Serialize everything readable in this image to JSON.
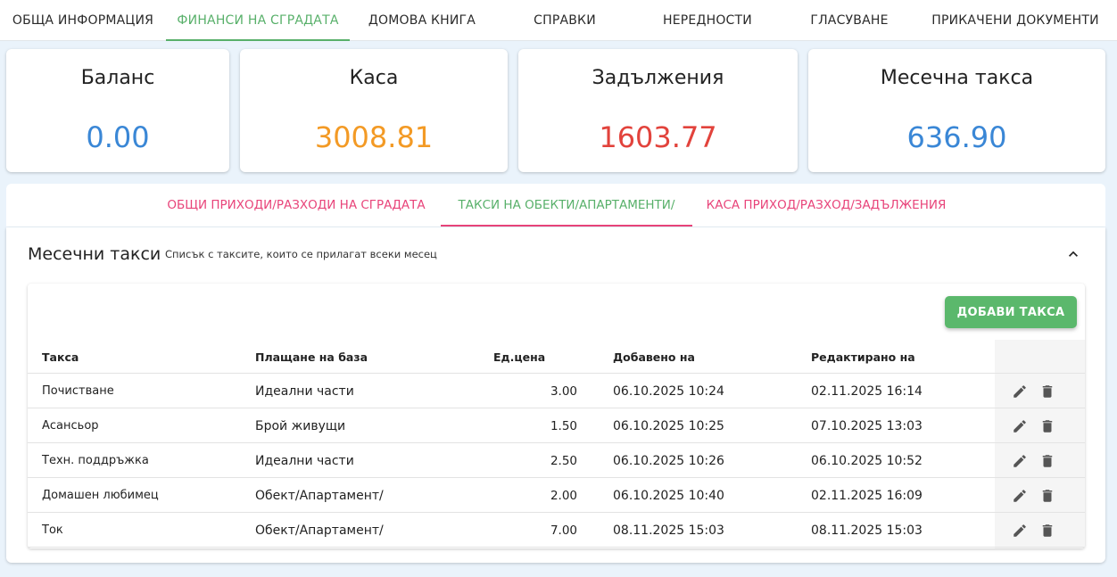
{
  "nav": {
    "tabs": [
      {
        "label": "Обща информация"
      },
      {
        "label": "Финанси на сградата"
      },
      {
        "label": "Домова книга"
      },
      {
        "label": "Справки"
      },
      {
        "label": "Нередности"
      },
      {
        "label": "Гласуване"
      },
      {
        "label": "Прикачени документи"
      }
    ],
    "active_index": 1
  },
  "stats": [
    {
      "label": "Баланс",
      "value": "0.00",
      "color": "#3a87d6"
    },
    {
      "label": "Каса",
      "value": "3008.81",
      "color": "#f39a25"
    },
    {
      "label": "Задължения",
      "value": "1603.77",
      "color": "#e2433c"
    },
    {
      "label": "Месечна такса",
      "value": "636.90",
      "color": "#3a87d6"
    }
  ],
  "subtabs": [
    {
      "label": "Общи приходи/разходи на сградата"
    },
    {
      "label": "Такси на обекти/апартаменти/"
    },
    {
      "label": "Каса приход/разход/задължения"
    }
  ],
  "subtabs_active_index": 1,
  "panel": {
    "title": "Месечни такси",
    "subtitle": "Списък с таксите, които се прилагат всеки месец",
    "add_button": "ДОБАВИ ТАКСА",
    "columns": [
      "Такса",
      "Плащане на база",
      "Ед.цена",
      "Добавено на",
      "Редактирано на"
    ],
    "rows": [
      {
        "name": "Почистване",
        "basis": "Идеални части",
        "price": "3.00",
        "added": "06.10.2025 10:24",
        "edited": "02.11.2025 16:14"
      },
      {
        "name": "Асансьор",
        "basis": "Брой живущи",
        "price": "1.50",
        "added": "06.10.2025 10:25",
        "edited": "07.10.2025 13:03"
      },
      {
        "name": "Техн. поддръжка",
        "basis": "Идеални части",
        "price": "2.50",
        "added": "06.10.2025 10:26",
        "edited": "06.10.2025 10:52"
      },
      {
        "name": "Домашен любимец",
        "basis": "Обект/Апартамент/",
        "price": "2.00",
        "added": "06.10.2025 10:40",
        "edited": "02.11.2025 16:09"
      },
      {
        "name": "Ток",
        "basis": "Обект/Апартамент/",
        "price": "7.00",
        "added": "08.11.2025 15:03",
        "edited": "08.11.2025 15:03"
      }
    ],
    "icons": {
      "edit": "pencil-icon",
      "delete": "trash-icon",
      "collapse": "chevron-up-icon"
    }
  }
}
